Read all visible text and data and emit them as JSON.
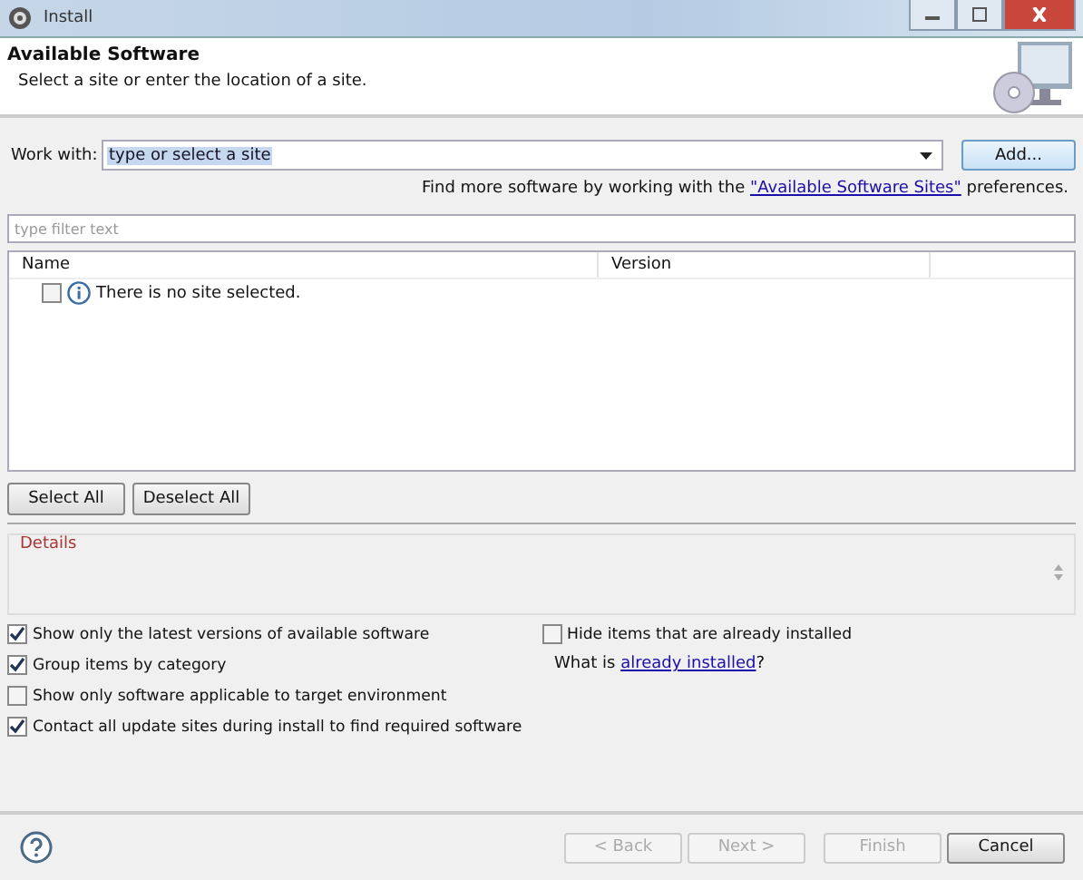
{
  "window": {
    "title": "Install"
  },
  "header": {
    "title": "Available Software",
    "subtitle": "Select a site or enter the location of a site."
  },
  "work_with": {
    "label": "Work with:",
    "value": "type or select a site",
    "add_button": "Add..."
  },
  "more_software": {
    "before": "Find more software by working with the",
    "link": "\"Available Software Sites\"",
    "after": "preferences."
  },
  "filter": {
    "placeholder": "type filter text"
  },
  "table": {
    "columns": [
      "Name",
      "Version"
    ],
    "rows": [
      {
        "text": "There is no site selected.",
        "checked": false
      }
    ]
  },
  "selection_buttons": [
    "Select All",
    "Deselect All"
  ],
  "details": {
    "title": "Details"
  },
  "options_left": [
    {
      "label": "Show only the latest versions of available software",
      "checked": true
    },
    {
      "label": "Group items by category",
      "checked": true
    },
    {
      "label": "Show only software applicable to target environment",
      "checked": false
    },
    {
      "label": "Contact all update sites during install to find required software",
      "checked": true
    }
  ],
  "options_right": {
    "checkbox": {
      "label": "Hide items that are already installed",
      "checked": false
    },
    "what_is": "What is",
    "link": "already installed",
    "after": "?"
  },
  "footer_buttons": [
    {
      "label": "< Back",
      "disabled": true
    },
    {
      "label": "Next >",
      "disabled": true
    },
    {
      "label": "Finish",
      "disabled": true
    },
    {
      "label": "Cancel",
      "disabled": false
    }
  ]
}
